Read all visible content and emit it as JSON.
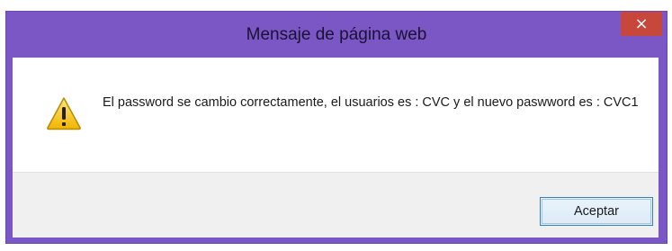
{
  "dialog": {
    "title": "Mensaje de página web",
    "close_glyph": "×",
    "icon": "warning-icon",
    "message": "El password se cambio correctamente, el usuarios es : CVC y el nuevo paswword es : CVC1",
    "ok_label": "Aceptar"
  },
  "colors": {
    "frame": "#7a57c4",
    "close": "#c7473a",
    "button_border": "#3c7fb1"
  }
}
